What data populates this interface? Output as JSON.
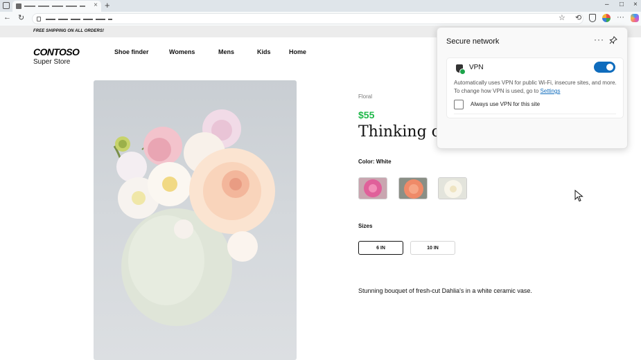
{
  "browser": {
    "new_tab": "+",
    "tab_close": "×",
    "window_controls": [
      "–",
      "□",
      "×"
    ],
    "nav": [
      "←",
      "↻"
    ],
    "toolbar_icons": [
      "☆",
      "⟲",
      "···"
    ]
  },
  "promo": {
    "text": "FREE SHIPPING ON ALL ORDERS!"
  },
  "store": {
    "logo": "CONTOSO",
    "logo_sub": "Super Store",
    "nav": [
      "Shoe finder",
      "Womens",
      "Mens",
      "Kids",
      "Home"
    ]
  },
  "product": {
    "breadcrumb": "Floral",
    "price": "$55",
    "title": "Thinking of",
    "color_label": "Color: White",
    "swatches": [
      "pink",
      "orange",
      "white"
    ],
    "sizes_label": "Sizes",
    "sizes": [
      "6 IN",
      "10 IN"
    ],
    "selected_size": "6 IN",
    "description": "Stunning bouquet of fresh-cut Dahlia's in a white ceramic vase."
  },
  "flyout": {
    "title": "Secure network",
    "more": "···",
    "vpn_label": "VPN",
    "vpn_on": true,
    "description": "Automatically uses VPN for public Wi-Fi, insecure sites, and more. To change how VPN is used, go to",
    "settings_link": "Settings",
    "checkbox_label": "Always use VPN for this site",
    "checkbox_checked": false
  },
  "colors": {
    "price_green": "#1eb849",
    "toggle_blue": "#0f6cbd",
    "link_blue": "#0f6cbd"
  }
}
